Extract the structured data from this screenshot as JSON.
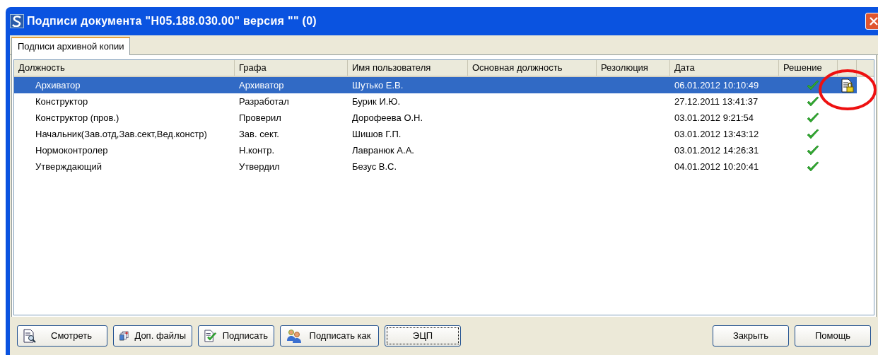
{
  "window": {
    "title": "Подписи документа \"Н05.188.030.00\" версия \"\" (0)"
  },
  "tabs": [
    {
      "label": "Подписи архивной копии",
      "selected": true
    }
  ],
  "table": {
    "columns": [
      "Должность",
      "Графа",
      "Имя пользователя",
      "Основная должность",
      "Резолюция",
      "Дата",
      "Решение"
    ],
    "rows": [
      {
        "position": "Архиватор",
        "field": "Архиватор",
        "user": "Шутько Е.В.",
        "date": "06.01.2012 10:10:49",
        "approved": true,
        "certificate": true,
        "selected": true
      },
      {
        "position": "Конструктор",
        "field": "Разработал",
        "user": "Бурик И.Ю.",
        "date": "27.12.2011 13:41:37",
        "approved": true,
        "certificate": false,
        "selected": false
      },
      {
        "position": "Конструктор (пров.)",
        "field": "Проверил",
        "user": "Дорофеева О.Н.",
        "date": "03.01.2012 9:21:54",
        "approved": true,
        "certificate": false,
        "selected": false
      },
      {
        "position": "Начальник(Зав.отд,Зав.сект,Вед.констр)",
        "field": "Зав. сект.",
        "user": "Шишов Г.П.",
        "date": "03.01.2012 13:43:12",
        "approved": true,
        "certificate": false,
        "selected": false
      },
      {
        "position": "Нормоконтролер",
        "field": "Н.контр.",
        "user": "Лавранюк А.А.",
        "date": "03.01.2012 14:26:31",
        "approved": true,
        "certificate": false,
        "selected": false
      },
      {
        "position": "Утверждающий",
        "field": "Утвердил",
        "user": "Безус В.С.",
        "date": "04.01.2012 10:20:41",
        "approved": true,
        "certificate": false,
        "selected": false
      }
    ]
  },
  "buttons_left": [
    {
      "label": "Смотреть",
      "kind": "view"
    },
    {
      "label": "Доп. файлы",
      "kind": "files"
    },
    {
      "label": "Подписать",
      "kind": "sign"
    },
    {
      "label": "Подписать как",
      "kind": "users"
    },
    {
      "label": "ЭЦП",
      "kind": "plain"
    }
  ],
  "buttons_right": [
    "Закрыть",
    "Помощь"
  ],
  "annotation": {
    "kind": "circle"
  }
}
